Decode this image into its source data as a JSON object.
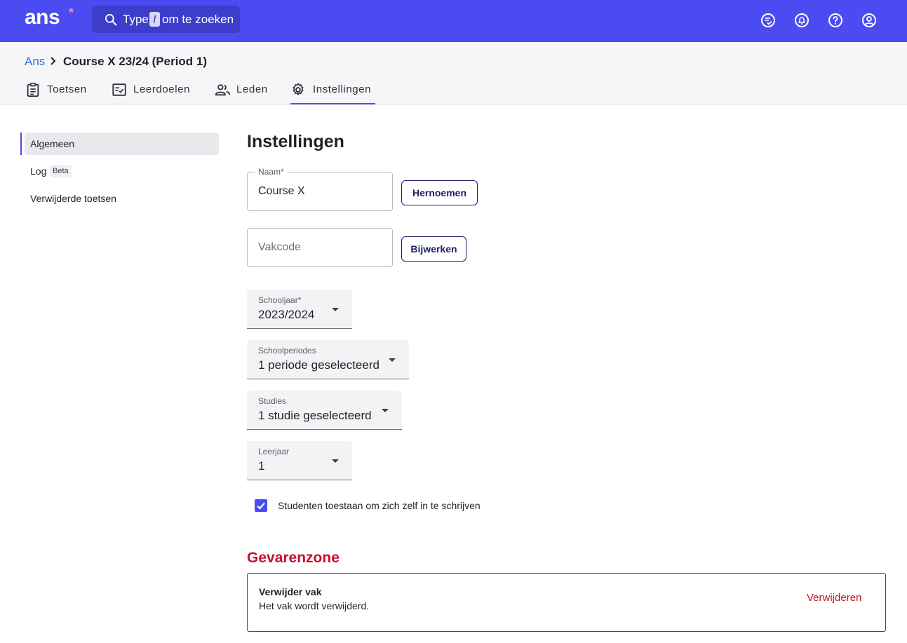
{
  "topbar": {
    "logo_text": "ans",
    "logo_star": "*",
    "search_prefix": "Type",
    "search_key": "/",
    "search_suffix": "om te zoeken",
    "icons": [
      "todo-list-icon",
      "notification-bell-icon",
      "help-icon",
      "account-icon"
    ]
  },
  "breadcrumb": {
    "root": "Ans",
    "current": "Course X 23/24 (Period 1)"
  },
  "tabs": [
    {
      "label": "Toetsen",
      "icon": "clipboard-icon"
    },
    {
      "label": "Leerdoelen",
      "icon": "checklist-icon"
    },
    {
      "label": "Leden",
      "icon": "people-icon"
    },
    {
      "label": "Instellingen",
      "icon": "gear-icon",
      "active": true
    }
  ],
  "sidenav": {
    "items": [
      {
        "label": "Algemeen",
        "active": true
      },
      {
        "label": "Log",
        "badge": "Beta"
      },
      {
        "label": "Verwijderde toetsen"
      }
    ]
  },
  "main": {
    "title": "Instellingen",
    "name_field": {
      "label": "Naam*",
      "value": "Course X"
    },
    "rename_button": "Hernoemen",
    "course_code_field": {
      "placeholder": "Vakcode"
    },
    "update_button": "Bijwerken",
    "school_year": {
      "label": "Schooljaar*",
      "value": "2023/2024"
    },
    "school_periods": {
      "label": "Schoolperiodes",
      "value": "1 periode geselecteerd"
    },
    "studies": {
      "label": "Studies",
      "value": "1 studie geselecteerd"
    },
    "year_level": {
      "label": "Leerjaar",
      "value": "1"
    },
    "self_enroll": {
      "label": "Studenten toestaan om zich zelf in te schrijven",
      "checked": true
    }
  },
  "danger_zone": {
    "title": "Gevarenzone",
    "heading": "Verwijder vak",
    "description": "Het vak wordt verwijderd.",
    "action": "Verwijderen"
  },
  "colors": {
    "brand": "#4b4bf2",
    "danger": "#c8102e",
    "link": "#2f6fd6",
    "button_text": "#1c1f6b"
  }
}
